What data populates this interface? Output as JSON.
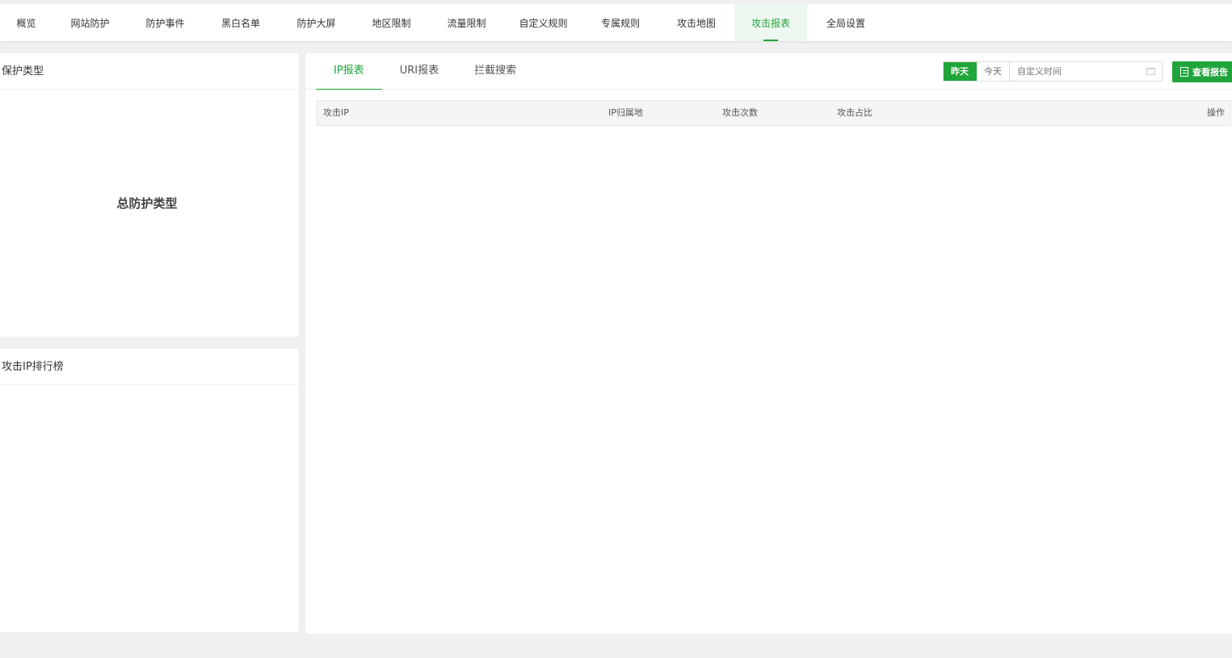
{
  "nav": {
    "items": [
      {
        "label": "概览"
      },
      {
        "label": "网站防护"
      },
      {
        "label": "防护事件"
      },
      {
        "label": "黑白名单"
      },
      {
        "label": "防护大屏"
      },
      {
        "label": "地区限制"
      },
      {
        "label": "流量限制"
      },
      {
        "label": "自定义规则"
      },
      {
        "label": "专属规则"
      },
      {
        "label": "攻击地图"
      },
      {
        "label": "攻击报表"
      },
      {
        "label": "全局设置"
      }
    ],
    "active": "攻击报表"
  },
  "protect_panel": {
    "title": "保护类型",
    "center_label": "总防护类型"
  },
  "rank_panel": {
    "title": "攻击IP排行榜"
  },
  "report": {
    "tabs": [
      "IP报表",
      "URI报表",
      "拦截搜索"
    ],
    "active_tab": "IP报表",
    "date_buttons": [
      "昨天",
      "今天"
    ],
    "active_date": "昨天",
    "date_placeholder": "自定义时间",
    "report_button": "查看报告",
    "table_headers": [
      "攻击IP",
      "IP归属地",
      "攻击次数",
      "攻击占比",
      "操作"
    ],
    "rows": []
  },
  "colors": {
    "accent": "#20a53a",
    "background": "#f0f0f0"
  }
}
